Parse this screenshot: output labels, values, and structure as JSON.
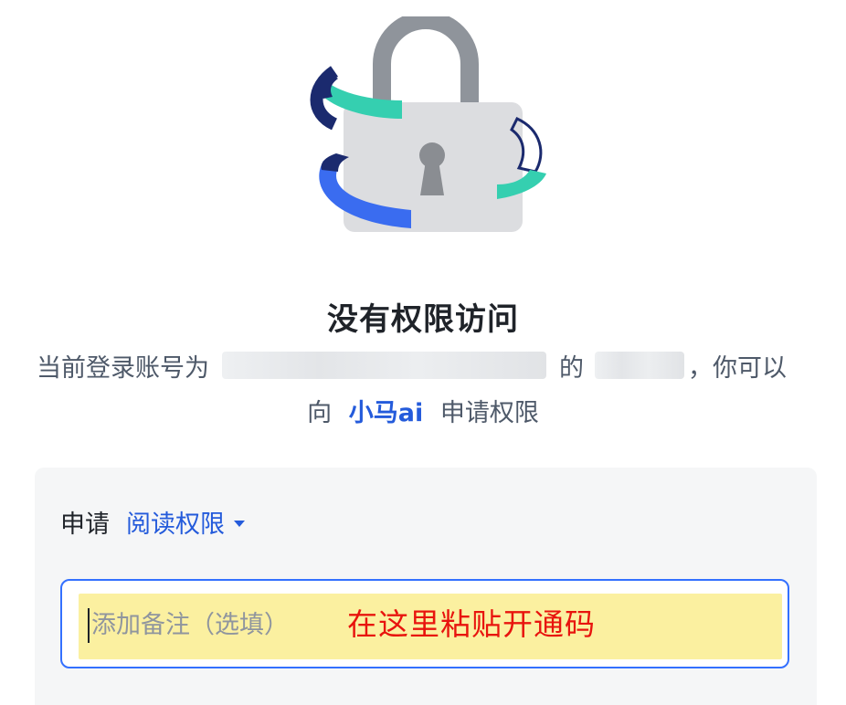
{
  "illustration": {
    "icon": "padlock-icon",
    "colors": {
      "shackle": "#8f949b",
      "body": "#dcdde0",
      "keyhole": "#8a8d92",
      "ring_navy": "#1b2a6e",
      "ring_teal": "#35cfb0",
      "ring_blue": "#3a6cf0"
    }
  },
  "title": "没有权限访问",
  "description": {
    "prefix": "当前登录账号为",
    "middle": "的",
    "suffix": "，你可以",
    "line2_prefix": "向",
    "owner_name": "小马ai",
    "line2_suffix": "申请权限"
  },
  "request": {
    "label": "申请",
    "permission_selected": "阅读权限",
    "note_placeholder": "添加备注（选填）",
    "annotation": "在这里粘贴开通码"
  },
  "colors": {
    "accent": "#245bdb",
    "input_border": "#3370ff",
    "highlight": "#fbf0a0",
    "annotation_red": "#e8140e",
    "panel_bg": "#f5f6f7"
  }
}
